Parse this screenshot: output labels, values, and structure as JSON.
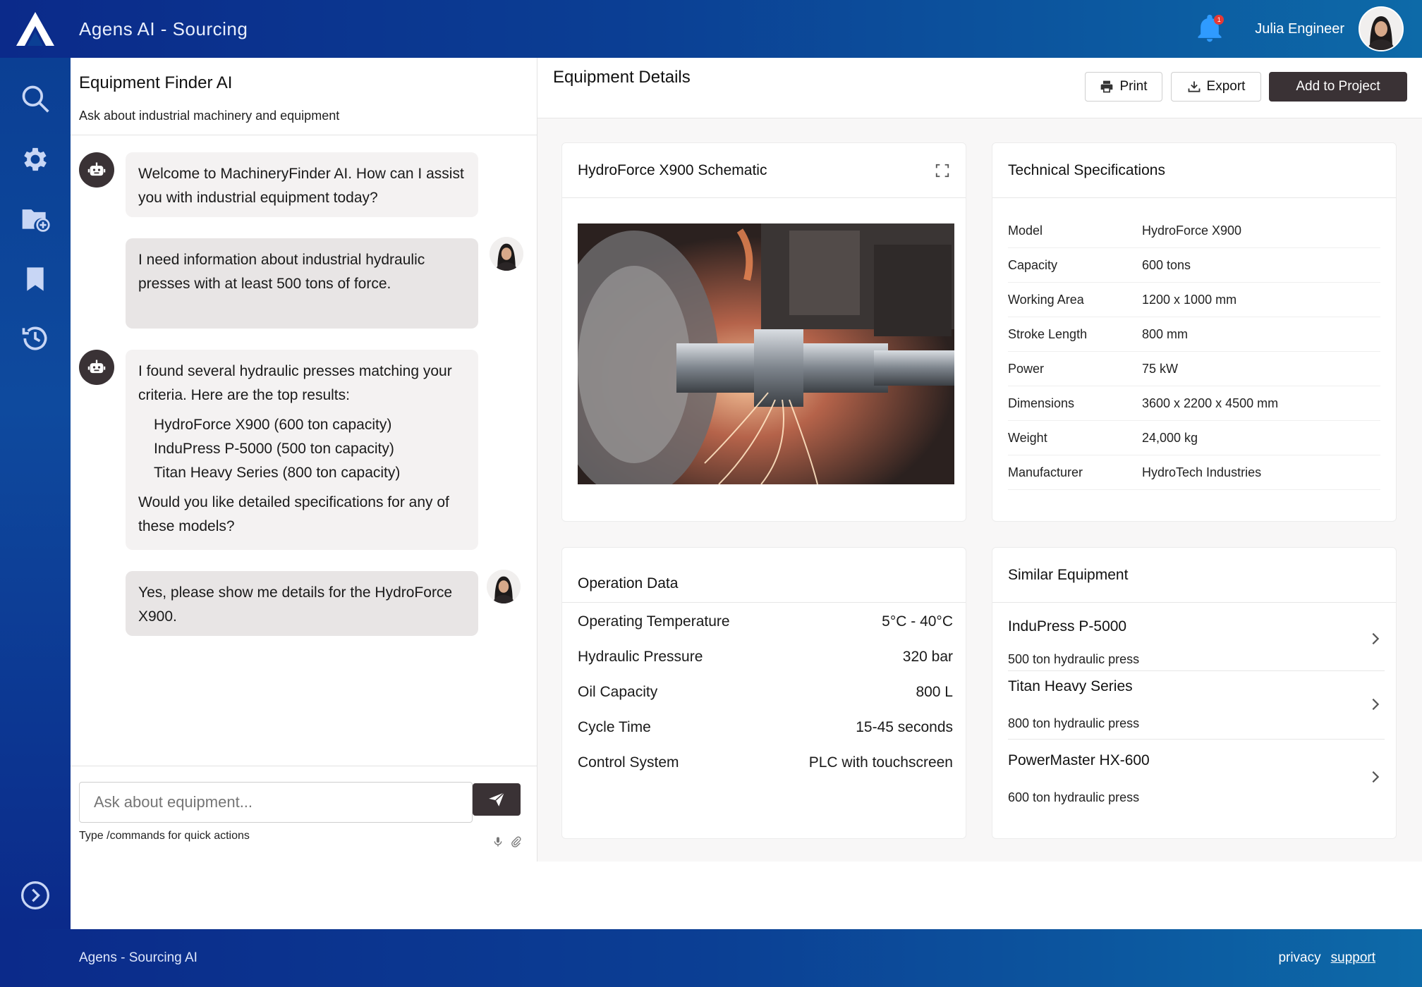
{
  "app": {
    "title": "Agens AI - Sourcing"
  },
  "user": {
    "name": "Julia Engineer",
    "notifications": "1"
  },
  "sidebar": {
    "items": [
      {
        "icon": "search-icon"
      },
      {
        "icon": "gear-icon"
      },
      {
        "icon": "folder-add-icon"
      },
      {
        "icon": "bookmark-icon"
      },
      {
        "icon": "history-icon"
      }
    ],
    "expand_icon": "chevron-right-circle-icon"
  },
  "chat": {
    "title": "Equipment Finder AI",
    "subtitle": "Ask about industrial machinery and equipment",
    "messages": [
      {
        "role": "bot",
        "text": "Welcome to MachineryFinder AI. How can I assist you with industrial equipment today?"
      },
      {
        "role": "user",
        "text": "I need information about industrial hydraulic presses with at least 500 tons of force."
      },
      {
        "role": "bot",
        "intro": "I found several hydraulic presses matching your criteria. Here are the top results:",
        "list": [
          "HydroForce X900 (600 ton capacity)",
          "InduPress P-5000 (500 ton capacity)",
          "Titan Heavy Series (800 ton capacity)"
        ],
        "outro": "Would you like detailed specifications for any of these models?"
      },
      {
        "role": "user",
        "text": "Yes, please show me details for the HydroForce X900."
      }
    ],
    "input_placeholder": "Ask about equipment...",
    "hint": "Type /commands for quick actions"
  },
  "details": {
    "title": "Equipment Details",
    "buttons": {
      "print": "Print",
      "export": "Export",
      "add": "Add to Project"
    },
    "schematic": {
      "title": "HydroForce X900 Schematic"
    },
    "specs": {
      "title": "Technical Specifications",
      "rows": [
        {
          "k": "Model",
          "v": "HydroForce X900"
        },
        {
          "k": "Capacity",
          "v": "600 tons"
        },
        {
          "k": "Working Area",
          "v": "1200 x 1000 mm"
        },
        {
          "k": "Stroke Length",
          "v": "800 mm"
        },
        {
          "k": "Power",
          "v": "75 kW"
        },
        {
          "k": "Dimensions",
          "v": "3600 x 2200 x 4500 mm"
        },
        {
          "k": "Weight",
          "v": "24,000 kg"
        },
        {
          "k": "Manufacturer",
          "v": "HydroTech Industries"
        }
      ]
    },
    "operation": {
      "title": "Operation Data",
      "rows": [
        {
          "k": "Operating Temperature",
          "v": "5°C - 40°C"
        },
        {
          "k": "Hydraulic Pressure",
          "v": "320 bar"
        },
        {
          "k": "Oil Capacity",
          "v": "800 L"
        },
        {
          "k": "Cycle Time",
          "v": "15-45 seconds"
        },
        {
          "k": "Control System",
          "v": "PLC with touchscreen"
        }
      ]
    },
    "similar": {
      "title": "Similar Equipment",
      "items": [
        {
          "name": "InduPress P-5000",
          "desc": "500 ton hydraulic press"
        },
        {
          "name": "Titan Heavy Series",
          "desc": "800 ton hydraulic press"
        },
        {
          "name": "PowerMaster HX-600",
          "desc": "600 ton hydraulic press"
        }
      ]
    }
  },
  "footer": {
    "title": "Agens - Sourcing AI",
    "privacy": "privacy",
    "support": "support"
  },
  "colors": {
    "brand_dark": "#0b2a8a",
    "brand_light": "#0d6aa8",
    "button_dark": "#3a3235",
    "bell": "#2f9bff"
  }
}
